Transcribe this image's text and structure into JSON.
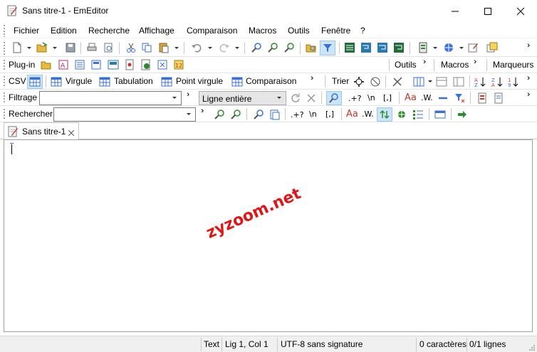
{
  "window": {
    "title": "Sans titre-1 - EmEditor"
  },
  "menu": [
    "Fichier",
    "Edition",
    "Recherche",
    "Affichage",
    "Comparaison",
    "Macros",
    "Outils",
    "Fenêtre",
    "?"
  ],
  "plugin_bar": {
    "label": "Plug-in",
    "outils": "Outils",
    "macros": "Macros",
    "marqueurs": "Marqueurs"
  },
  "csv_bar": {
    "label": "CSV",
    "virgule": "Virgule",
    "tabulation": "Tabulation",
    "point_virgule": "Point virgule",
    "comparaison": "Comparaison",
    "trier": "Trier"
  },
  "filter_bar": {
    "label": "Filtrage",
    "mode": "Ligne entière",
    "regex": ".+?",
    "newline": "\\n",
    "brackets": "[,]",
    "case": "Aa",
    "word": ".W."
  },
  "search_bar": {
    "label": "Rechercher",
    "regex": ".+?",
    "newline": "\\n",
    "brackets": "[,]",
    "case": "Aa",
    "word": ".W."
  },
  "tabs": [
    {
      "label": "Sans titre-1"
    }
  ],
  "watermark": "zyzoom.net",
  "status": {
    "type": "Text",
    "position": "Lig 1, Col 1",
    "encoding": "UTF-8 sans signature",
    "chars": "0 caractères",
    "lines": "0/1 lignes"
  }
}
